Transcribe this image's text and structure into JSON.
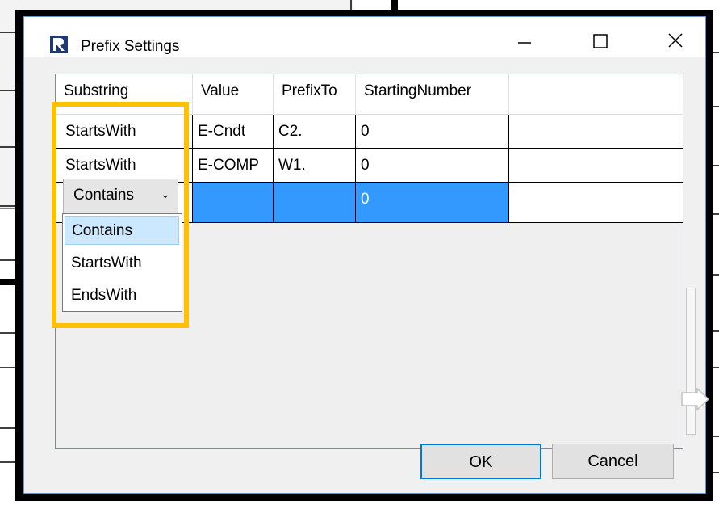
{
  "window": {
    "title": "Prefix Settings"
  },
  "titlebar_buttons": {
    "minimize": "minimize",
    "maximize": "maximize",
    "close": "close"
  },
  "grid": {
    "columns": [
      "Substring",
      "Value",
      "PrefixTo",
      "StartingNumber"
    ],
    "rows": [
      {
        "substring": "StartsWith",
        "value": "E-Cndt",
        "prefix_to": "C2.",
        "starting_number": "0"
      },
      {
        "substring": "StartsWith",
        "value": "E-COMP",
        "prefix_to": "W1.",
        "starting_number": "0"
      },
      {
        "substring": "Contains",
        "value": "",
        "prefix_to": "",
        "starting_number": "0"
      }
    ]
  },
  "dropdown": {
    "selected": "Contains",
    "options": [
      "Contains",
      "StartsWith",
      "EndsWith"
    ]
  },
  "buttons": {
    "ok": "OK",
    "cancel": "Cancel"
  },
  "colors": {
    "highlight_frame": "#ffc000",
    "selection": "#3399ff",
    "hover_item": "#cce8ff"
  }
}
